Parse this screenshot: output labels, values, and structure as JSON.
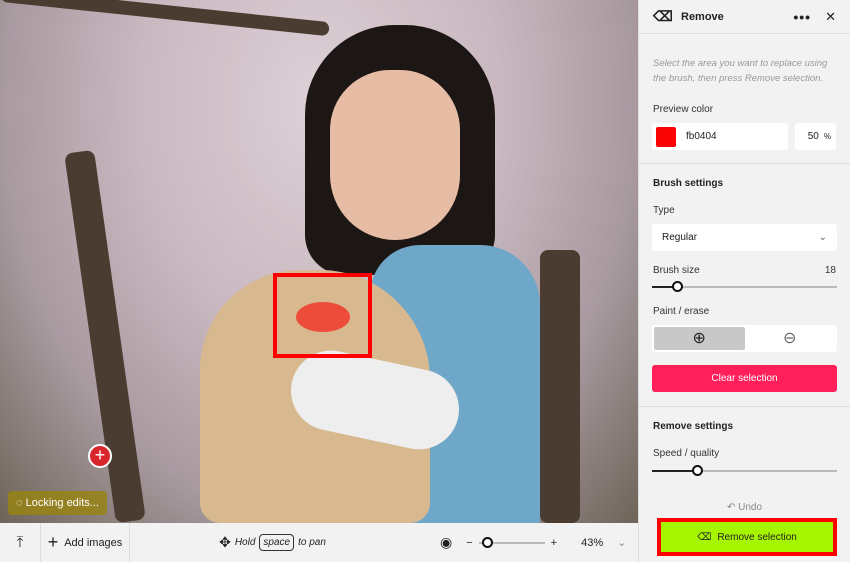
{
  "panel": {
    "title": "Remove",
    "icon": "eraser-icon",
    "hint": "Select the area you want to replace using the brush, then press Remove selection.",
    "preview_color_label": "Preview color",
    "preview_color_hex": "fb0404",
    "preview_color": "#fb0404",
    "opacity": "50",
    "opacity_unit": "%",
    "brush_settings": "Brush settings",
    "type_label": "Type",
    "type_value": "Regular",
    "brush_size_label": "Brush size",
    "brush_size": "18",
    "brush_size_fraction": 0.1,
    "paint_erase_label": "Paint / erase",
    "clear_selection": "Clear selection",
    "remove_settings": "Remove settings",
    "speed_quality_label": "Speed / quality",
    "speed_quality_fraction": 0.25,
    "undo": "Undo",
    "remove_selection": "Remove selection",
    "accent_red": "#ff1f5a",
    "accent_green": "#a6f500"
  },
  "canvas": {
    "locking": "Locking edits..."
  },
  "bottom": {
    "add_images": "Add images",
    "hold": "Hold",
    "space": "space",
    "to_pan": "to pan",
    "zoom": "43%",
    "zoom_fraction": 0.1
  }
}
